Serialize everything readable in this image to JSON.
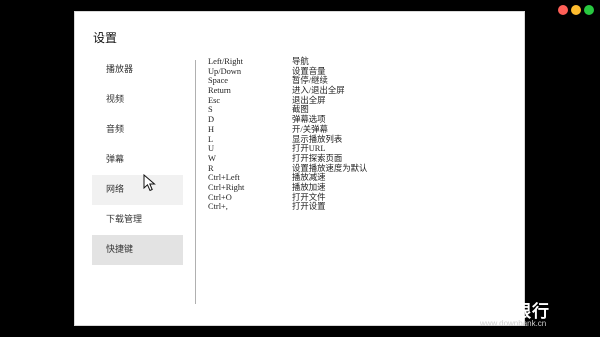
{
  "window": {
    "title": "设置"
  },
  "sidebar": {
    "items": [
      {
        "label": "播放器"
      },
      {
        "label": "视频"
      },
      {
        "label": "音频"
      },
      {
        "label": "弹幕"
      },
      {
        "label": "网络"
      },
      {
        "label": "下载管理"
      },
      {
        "label": "快捷键"
      }
    ],
    "hovered": "网络",
    "selected": "快捷键"
  },
  "shortcuts": [
    {
      "key": "Left/Right",
      "action": "导航"
    },
    {
      "key": "Up/Down",
      "action": "设置音量"
    },
    {
      "key": "Space",
      "action": "暂停/继续"
    },
    {
      "key": "Return",
      "action": "进入/退出全屏"
    },
    {
      "key": "Esc",
      "action": "退出全屏"
    },
    {
      "key": "S",
      "action": "截图"
    },
    {
      "key": "D",
      "action": "弹幕选项"
    },
    {
      "key": "H",
      "action": "开/关弹幕"
    },
    {
      "key": "L",
      "action": "显示播放列表"
    },
    {
      "key": "U",
      "action": "打开URL"
    },
    {
      "key": "W",
      "action": "打开探索页面"
    },
    {
      "key": "R",
      "action": "设置播放速度为默认"
    },
    {
      "key": "Ctrl+Left",
      "action": "播放减速"
    },
    {
      "key": "Ctrl+Right",
      "action": "播放加速"
    },
    {
      "key": "Ctrl+O",
      "action": "打开文件"
    },
    {
      "key": "Ctrl+,",
      "action": "打开设置"
    }
  ],
  "watermark": {
    "title": "下载银行",
    "url": "www.downbank.cn"
  },
  "icons": {
    "cursor": "mouse-pointer-icon",
    "logo": "watermark-logo-icon"
  }
}
